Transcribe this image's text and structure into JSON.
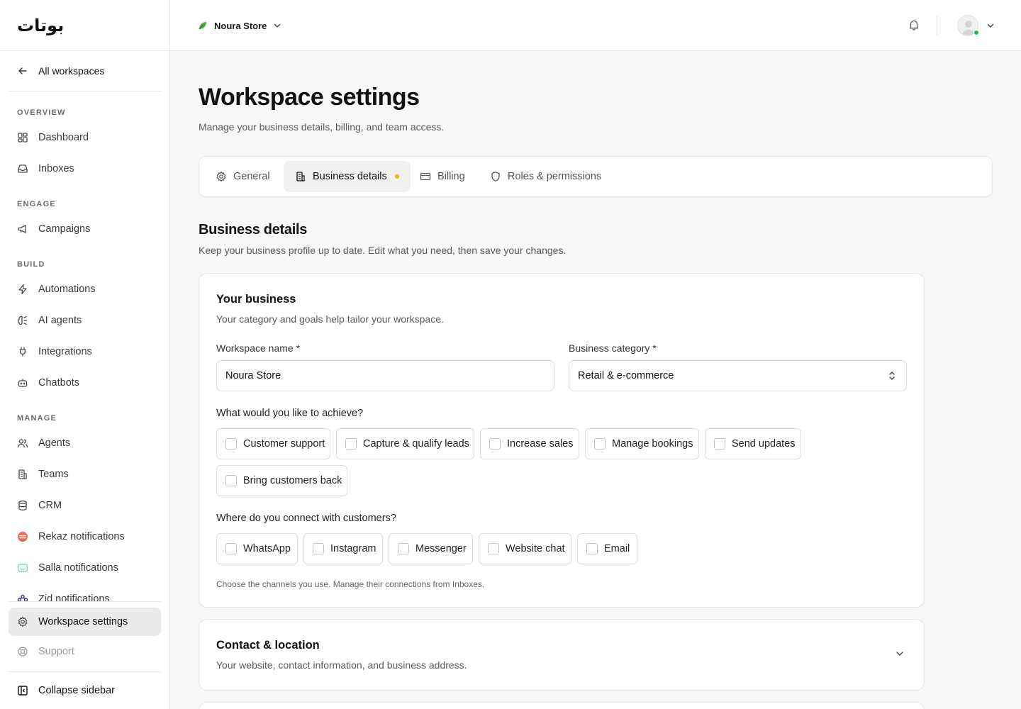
{
  "brand": {
    "logo_text": "بوتات"
  },
  "sidebar": {
    "back": "All workspaces",
    "sections": {
      "overview": "OVERVIEW",
      "engage": "ENGAGE",
      "build": "BUILD",
      "manage": "MANAGE"
    },
    "items": {
      "dashboard": "Dashboard",
      "inboxes": "Inboxes",
      "campaigns": "Campaigns",
      "automations": "Automations",
      "ai_agents": "AI agents",
      "integrations": "Integrations",
      "chatbots": "Chatbots",
      "agents": "Agents",
      "teams": "Teams",
      "crm": "CRM",
      "rekaz": "Rekaz notifications",
      "salla": "Salla notifications",
      "zid": "Zid notifications",
      "workspace_settings": "Workspace settings",
      "support": "Support"
    },
    "collapse": "Collapse sidebar"
  },
  "header": {
    "store_name": "Noura Store"
  },
  "page": {
    "title": "Workspace settings",
    "subtitle": "Manage your business details, billing, and team access.",
    "tabs": {
      "general": "General",
      "business": "Business details",
      "billing": "Billing",
      "roles": "Roles & permissions"
    },
    "section_title": "Business details",
    "section_subtitle": "Keep your business profile up to date. Edit what you need, then save your changes."
  },
  "your_business": {
    "title": "Your business",
    "subtitle": "Your category and goals help tailor your workspace.",
    "workspace_name_label": "Workspace name *",
    "workspace_name_value": "Noura Store",
    "category_label": "Business category *",
    "category_value": "Retail & e-commerce",
    "goals_question": "What would you like to achieve?",
    "goals": {
      "support": "Customer support",
      "leads": "Capture & qualify leads",
      "sales": "Increase sales",
      "bookings": "Manage bookings",
      "updates": "Send updates",
      "back": "Bring customers back"
    },
    "channels_question": "Where do you connect with customers?",
    "channels": {
      "whatsapp": "WhatsApp",
      "instagram": "Instagram",
      "messenger": "Messenger",
      "website": "Website chat",
      "email": "Email"
    },
    "channels_hint": "Choose the channels you use. Manage their connections from Inboxes."
  },
  "contact": {
    "title": "Contact & location",
    "subtitle": "Your website, contact information, and business address."
  },
  "colors": {
    "active_tab_dot": "#f2b01e",
    "online_status": "#22b55a",
    "active_nav_bg": "#ebebeb"
  }
}
